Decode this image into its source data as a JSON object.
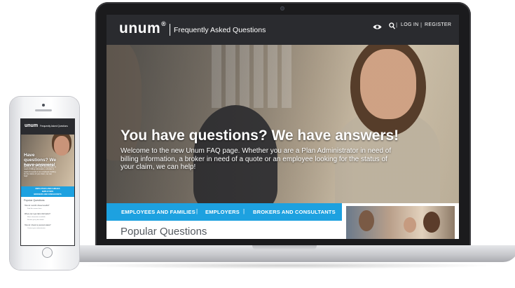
{
  "brand": {
    "logo_text": "unum",
    "logo_mark": "®",
    "accent_color": "#1da1e0",
    "header_color": "#2a2b2f"
  },
  "header": {
    "section_title": "Frequently Asked Questions",
    "visibility_icon": "eye-icon",
    "search_icon": "search-icon",
    "divider": "|",
    "login_label": "LOG IN",
    "register_label": "REGISTER"
  },
  "hero": {
    "headline": "You have questions? We have answers!",
    "body": "Welcome to the new Unum FAQ page. Whether you are a Plan Administrator in need of billing information, a broker in need of a quote or an employee looking for the status of your claim, we can help!"
  },
  "nav": {
    "items": [
      {
        "label": "EMPLOYEES AND FAMILIES"
      },
      {
        "label": "EMPLOYERS"
      },
      {
        "label": "BROKERS AND CONSULTANTS"
      }
    ],
    "separator": "|"
  },
  "main": {
    "popular_heading": "Popular Questions"
  },
  "mobile": {
    "logo_text": "unum",
    "section_title": "Frequently Asked Questions",
    "headline": "Have questions? We have answers!",
    "body": "Welcome to the new Unum FAQ page. Whether you are a Plan Administrator in need of billing information, a broker in need of a quote or an employee looking for the status of your claim, we can help!",
    "nav_items": [
      "EMPLOYEES AND FAMILIES",
      "EMPLOYERS",
      "BROKERS AND CONSULTANTS"
    ],
    "popular_heading": "Popular Questions",
    "questions": [
      "How do I enroll in these benefits?",
      "Where can I get claim information?",
      "How do I check my account status?"
    ],
    "sub_lines": [
      "Find the answer here",
      "More information available",
      "Review your plan details",
      "Contact your administrator"
    ]
  }
}
